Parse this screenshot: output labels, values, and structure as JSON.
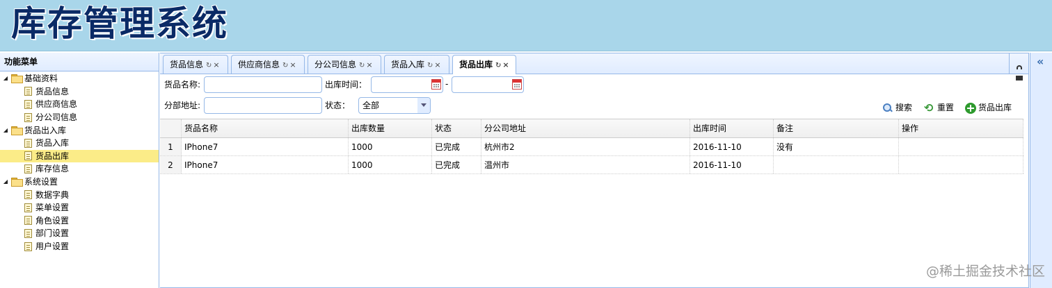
{
  "header": {
    "title": "库存管理系统"
  },
  "sidebar": {
    "title": "功能菜单",
    "groups": [
      {
        "label": "基础资料",
        "items": [
          "货品信息",
          "供应商信息",
          "分公司信息"
        ]
      },
      {
        "label": "货品出入库",
        "items": [
          "货品入库",
          "货品出库",
          "库存信息"
        ]
      },
      {
        "label": "系统设置",
        "items": [
          "数据字典",
          "菜单设置",
          "角色设置",
          "部门设置",
          "用户设置"
        ]
      }
    ],
    "selected": "货品出库"
  },
  "tabs": [
    {
      "label": "货品信息"
    },
    {
      "label": "供应商信息"
    },
    {
      "label": "分公司信息"
    },
    {
      "label": "货品入库"
    },
    {
      "label": "货品出库"
    }
  ],
  "tab_glyphs": {
    "refresh": "↻",
    "close": "×"
  },
  "form": {
    "name_label": "货品名称:",
    "time_label": "出库时间：",
    "time_sep": "-",
    "address_label": "分部地址:",
    "status_label": "状态：",
    "status_value": "全部",
    "name_value": "",
    "address_value": ""
  },
  "toolbar": {
    "search": "搜索",
    "reset": "重置",
    "outbound": "货品出库"
  },
  "grid": {
    "columns": [
      "货品名称",
      "出库数量",
      "状态",
      "分公司地址",
      "出库时间",
      "备注",
      "操作"
    ],
    "rows": [
      {
        "num": "1",
        "name": "IPhone7",
        "qty": "1000",
        "status": "已完成",
        "address": "杭州市2",
        "time": "2016-11-10",
        "remark": "没有",
        "op": ""
      },
      {
        "num": "2",
        "name": "IPhone7",
        "qty": "1000",
        "status": "已完成",
        "address": "温州市",
        "time": "2016-11-10",
        "remark": "",
        "op": ""
      }
    ]
  },
  "right_panel": {
    "collapse_glyph": "«"
  },
  "watermark": "@稀土掘金技术社区",
  "colors": {
    "header_bg": "#a9d6ea",
    "border": "#95b8e7",
    "selected_bg": "#fbec88"
  }
}
